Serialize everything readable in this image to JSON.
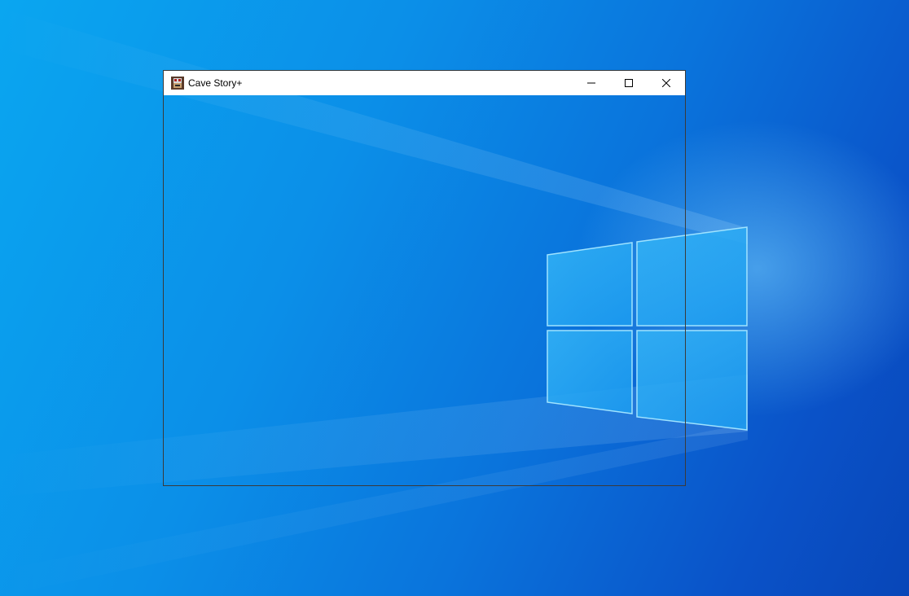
{
  "desktop": {
    "wallpaper": "windows-10-hero-wallpaper",
    "colors": {
      "base": "#0a74dc",
      "glow": "#7fd4ff",
      "logo_pane": "#3fb8f5"
    }
  },
  "window": {
    "title": "Cave Story+",
    "app_icon": "cave-story-icon",
    "caption_buttons": [
      {
        "name": "minimize",
        "icon": "minimize-icon"
      },
      {
        "name": "maximize",
        "icon": "maximize-icon"
      },
      {
        "name": "close",
        "icon": "close-icon"
      }
    ],
    "client_area": "empty-transparent"
  }
}
